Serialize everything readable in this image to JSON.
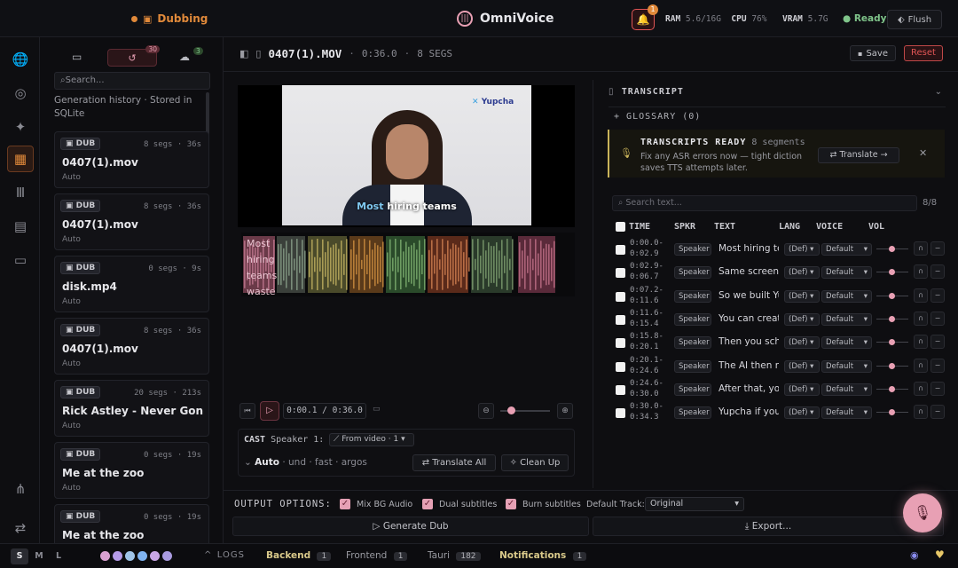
{
  "topbar": {
    "mode_label": "Dubbing",
    "app_title": "OmniVoice",
    "notif_count": "1",
    "ram_label": "RAM",
    "ram_value": "5.6/16G",
    "cpu_label": "CPU",
    "cpu_value": "76%",
    "vram_label": "VRAM",
    "vram_value": "5.7G",
    "status": "Ready",
    "flush_label": "Flush"
  },
  "history": {
    "history_count": "30",
    "cloud_count": "3",
    "search_placeholder": "Search...",
    "caption": "Generation history · Stored in SQLite",
    "items": [
      {
        "badge": "DUB",
        "meta": "8 segs · 36s",
        "name": "0407(1).mov",
        "mode": "Auto"
      },
      {
        "badge": "DUB",
        "meta": "8 segs · 36s",
        "name": "0407(1).mov",
        "mode": "Auto"
      },
      {
        "badge": "DUB",
        "meta": "0 segs · 9s",
        "name": "disk.mp4",
        "mode": "Auto"
      },
      {
        "badge": "DUB",
        "meta": "8 segs · 36s",
        "name": "0407(1).mov",
        "mode": "Auto"
      },
      {
        "badge": "DUB",
        "meta": "20 segs · 213s",
        "name": "Rick Astley - Never Gonn...",
        "mode": "Auto"
      },
      {
        "badge": "DUB",
        "meta": "0 segs · 19s",
        "name": "Me at the zoo",
        "mode": "Auto"
      },
      {
        "badge": "DUB",
        "meta": "0 segs · 19s",
        "name": "Me at the zoo",
        "mode": ""
      }
    ]
  },
  "file": {
    "name": "0407(1).MOV",
    "duration": "0:36.0",
    "segs": "8 SEGS",
    "save_label": "Save",
    "reset_label": "Reset"
  },
  "video": {
    "brand": "Yupcha",
    "subtitle_highlight": "Most",
    "subtitle_rest": "hiring teams",
    "wave_text": "Most hiring teams waste",
    "timecode": "0:00.1 / 0:36.0"
  },
  "cast": {
    "label": "CAST",
    "speaker": "Speaker 1:",
    "source": "From video · 1",
    "auto": "Auto",
    "settings": "· und · fast · argos",
    "translate_all": "Translate All",
    "clean_up": "Clean Up"
  },
  "transcript": {
    "header": "TRANSCRIPT",
    "glossary": "GLOSSARY (0)",
    "ready_title": "TRANSCRIPTS READY",
    "ready_count": "8 segments",
    "ready_line1": "Fix any ASR errors now — tight diction",
    "ready_line2": "saves TTS attempts later.",
    "translate_btn": "Translate",
    "search_placeholder": "Search text...",
    "search_count": "8/8",
    "columns": [
      "TIME",
      "SPKR",
      "TEXT",
      "LANG",
      "VOICE",
      "VOL"
    ],
    "rows": [
      {
        "t1": "0:00.0-",
        "t2": "0:02.9",
        "spkr": "Speaker 1",
        "text": "Most hiring te",
        "lang": "(Def)",
        "voice": "Default"
      },
      {
        "t1": "0:02.9-",
        "t2": "0:06.7",
        "spkr": "Speaker 1",
        "text": "Same screeni",
        "lang": "(Def)",
        "voice": "Default"
      },
      {
        "t1": "0:07.2-",
        "t2": "0:11.6",
        "spkr": "Speaker 1",
        "text": "So we built Yu",
        "lang": "(Def)",
        "voice": "Default"
      },
      {
        "t1": "0:11.6-",
        "t2": "0:15.4",
        "spkr": "Speaker 1",
        "text": "You can creat",
        "lang": "(Def)",
        "voice": "Default"
      },
      {
        "t1": "0:15.8-",
        "t2": "0:20.1",
        "spkr": "Speaker 1",
        "text": "Then you sch",
        "lang": "(Def)",
        "voice": "Default"
      },
      {
        "t1": "0:20.1-",
        "t2": "0:24.6",
        "spkr": "Speaker 1",
        "text": "The AI then ru",
        "lang": "(Def)",
        "voice": "Default"
      },
      {
        "t1": "0:24.6-",
        "t2": "0:30.0",
        "spkr": "Speaker 1",
        "text": "After that, you",
        "lang": "(Def)",
        "voice": "Default"
      },
      {
        "t1": "0:30.0-",
        "t2": "0:34.3",
        "spkr": "Speaker 1",
        "text": "Yupcha if you",
        "lang": "(Def)",
        "voice": "Default"
      }
    ]
  },
  "output": {
    "label": "OUTPUT OPTIONS:",
    "mix_bg": "Mix BG Audio",
    "dual_subs": "Dual subtitles",
    "burn_subs": "Burn subtitles",
    "default_track_label": "Default Track:",
    "default_track_value": "Original",
    "generate": "Generate Dub",
    "export": "Export..."
  },
  "statusbar": {
    "sizes": [
      "S",
      "M",
      "L"
    ],
    "logs": "LOGS",
    "backend": "Backend",
    "backend_count": "1",
    "frontend": "Frontend",
    "frontend_count": "1",
    "tauri": "Tauri",
    "tauri_count": "182",
    "notifications": "Notifications",
    "notifications_count": "1"
  },
  "colors": {
    "accent": "#e8a0b4",
    "orange": "#e0893a",
    "ready_green": "#7fc48a",
    "reset_red": "#e05555",
    "dots": [
      "#d9a0d0",
      "#b59be8",
      "#9fc4e8",
      "#7fb3f0",
      "#c9a7e6",
      "#a99be0"
    ]
  }
}
